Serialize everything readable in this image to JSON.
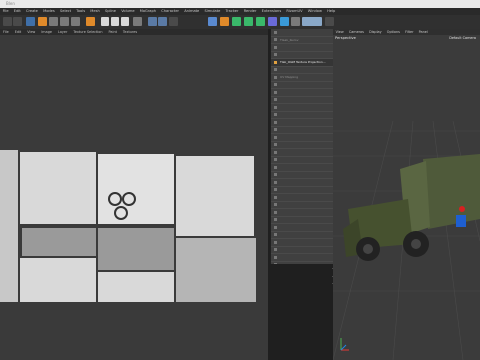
{
  "window": {
    "title": "Blen"
  },
  "menubar": {
    "items": [
      "File",
      "Edit",
      "Create",
      "Modes",
      "Select",
      "Tools",
      "Mesh",
      "Spline",
      "Volume",
      "MoGraph",
      "Character",
      "Animate",
      "Simulate",
      "Tracker",
      "Render",
      "Extensions",
      "RizomUV",
      "Window",
      "Help"
    ]
  },
  "uv_menu": {
    "items": [
      "File",
      "Edit",
      "View",
      "Image",
      "Layer",
      "Texture Selection",
      "Paint",
      "Textures"
    ]
  },
  "objects": {
    "rows": [
      "",
      "Tlaak_Kuzov",
      "",
      "",
      "Tlak_OGM Texture Projection...",
      "",
      "UV Mapping",
      "",
      "",
      "",
      "",
      "",
      "",
      "",
      "",
      "",
      "",
      "",
      "",
      "",
      "",
      "",
      "",
      "",
      "",
      "",
      "",
      "",
      "",
      "",
      "",
      "",
      "",
      ""
    ],
    "selected_index": 4
  },
  "viewport": {
    "menu": [
      "View",
      "Cameras",
      "Display",
      "Options",
      "Filter",
      "Panel"
    ],
    "label": "Perspective",
    "camera": "Default Camera"
  }
}
